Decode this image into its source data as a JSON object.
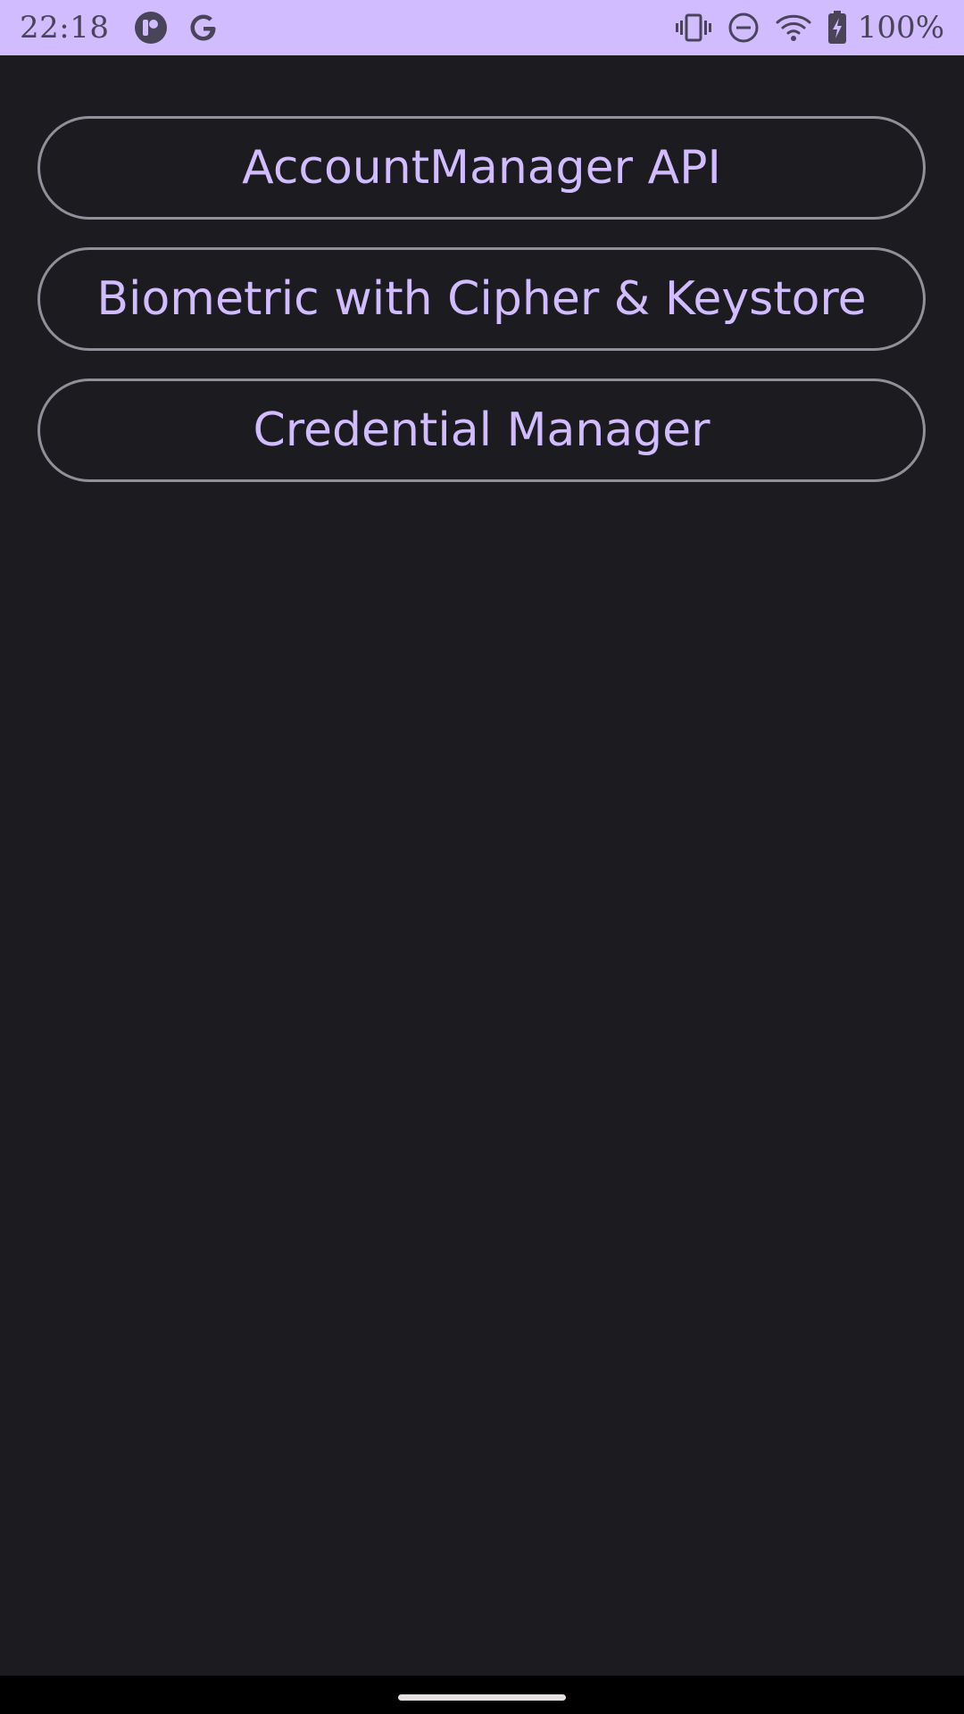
{
  "status_bar": {
    "time": "22:18",
    "battery_percent": "100%",
    "left_icons": [
      "app-notification-icon",
      "google-icon"
    ],
    "right_icons": [
      "vibrate-icon",
      "do-not-disturb-icon",
      "wifi-icon",
      "battery-charging-icon"
    ],
    "background_color": "#d0bcff"
  },
  "buttons": [
    {
      "label": "AccountManager API"
    },
    {
      "label": "Biometric with Cipher & Keystore"
    },
    {
      "label": "Credential Manager"
    }
  ],
  "colors": {
    "background": "#1c1b20",
    "button_text": "#d0bcff",
    "button_outline": "#938f99"
  }
}
